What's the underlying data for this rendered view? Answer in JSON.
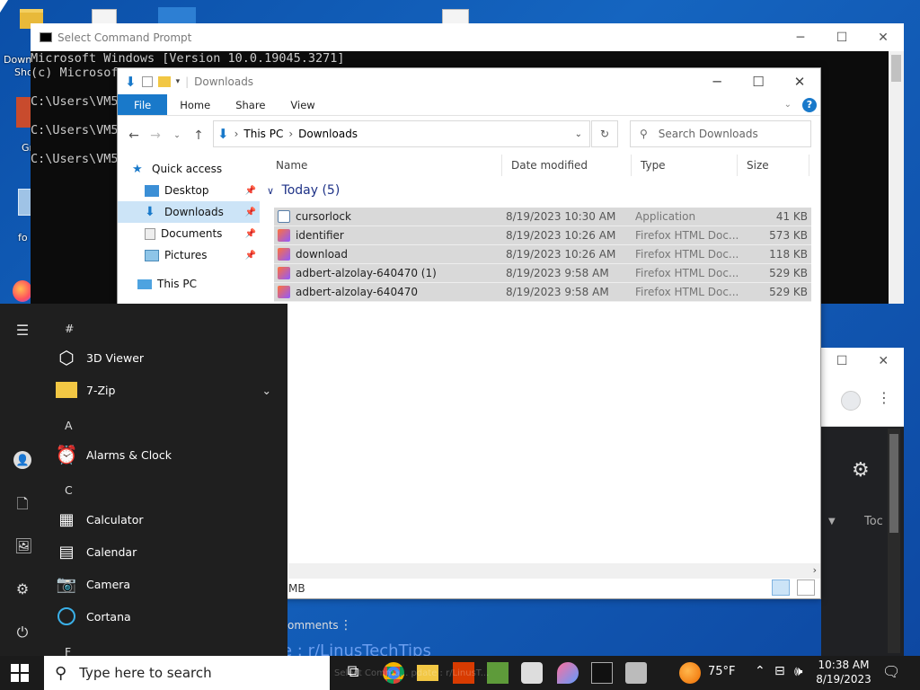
{
  "desktop": {
    "labels": [
      "Down",
      "Sho",
      "Gr",
      "fo"
    ]
  },
  "cmd": {
    "title": "Select Command Prompt",
    "lines": [
      "Microsoft Windows [Version 10.0.19045.3271]",
      "(c) Microsof",
      "",
      "C:\\Users\\VM5",
      "",
      "C:\\Users\\VM5",
      "",
      "C:\\Users\\VM5"
    ],
    "controls": [
      "─",
      "☐",
      "✕"
    ]
  },
  "explorer": {
    "title": "Downloads",
    "controls": [
      "─",
      "☐",
      "✕"
    ],
    "ribbon_tabs": [
      "File",
      "Home",
      "Share",
      "View"
    ],
    "help": "?",
    "breadcrumb": [
      "This PC",
      "Downloads"
    ],
    "search_placeholder": "Search Downloads",
    "nav": [
      {
        "label": "Quick access",
        "pinned": false,
        "selected": false
      },
      {
        "label": "Desktop",
        "pinned": true,
        "selected": false
      },
      {
        "label": "Downloads",
        "pinned": true,
        "selected": true
      },
      {
        "label": "Documents",
        "pinned": true,
        "selected": false
      },
      {
        "label": "Pictures",
        "pinned": true,
        "selected": false
      },
      {
        "label": "This PC",
        "pinned": false,
        "selected": false
      }
    ],
    "columns": [
      "Name",
      "Date modified",
      "Type",
      "Size"
    ],
    "group": "Today (5)",
    "files": [
      {
        "name": "cursorlock",
        "date": "8/19/2023 10:30 AM",
        "type": "Application",
        "size": "41 KB",
        "icon": "application-icon"
      },
      {
        "name": "identifier",
        "date": "8/19/2023 10:26 AM",
        "type": "Firefox HTML Doc...",
        "size": "573 KB",
        "icon": "firefox-html-icon"
      },
      {
        "name": "download",
        "date": "8/19/2023 10:26 AM",
        "type": "Firefox HTML Doc...",
        "size": "118 KB",
        "icon": "firefox-html-icon"
      },
      {
        "name": "adbert-alzolay-640470 (1)",
        "date": "8/19/2023 9:58 AM",
        "type": "Firefox HTML Doc...",
        "size": "529 KB",
        "icon": "firefox-html-icon"
      },
      {
        "name": "adbert-alzolay-640470",
        "date": "8/19/2023 9:58 AM",
        "type": "Firefox HTML Doc...",
        "size": "529 KB",
        "icon": "firefox-html-icon"
      }
    ],
    "status": "MB"
  },
  "browser": {
    "text_toc": "Toc",
    "comments": "omments",
    "link": "e : r/LinusTechTips"
  },
  "start_menu": {
    "sections": [
      {
        "header": "#",
        "items": [
          {
            "label": "3D Viewer",
            "icon": "cube-icon"
          },
          {
            "label": "7-Zip",
            "icon": "folder-icon",
            "expand": "⌄"
          }
        ]
      },
      {
        "header": "A",
        "items": [
          {
            "label": "Alarms & Clock",
            "icon": "alarm-clock-icon"
          }
        ]
      },
      {
        "header": "C",
        "items": [
          {
            "label": "Calculator",
            "icon": "calculator-icon"
          },
          {
            "label": "Calendar",
            "icon": "calendar-icon"
          },
          {
            "label": "Camera",
            "icon": "camera-icon"
          },
          {
            "label": "Cortana",
            "icon": "cortana-icon"
          }
        ]
      },
      {
        "header": "F",
        "items": []
      }
    ]
  },
  "taskbar": {
    "search_placeholder": "Type here to search",
    "weather": "75°F",
    "time": "10:38 AM",
    "date": "8/19/2023",
    "overlay": "Select Comma... pdate : r/LinusT..."
  },
  "colors": {
    "accent": "#1979ca",
    "selection": "#cce4f7",
    "row_select": "#d9d9d9"
  }
}
